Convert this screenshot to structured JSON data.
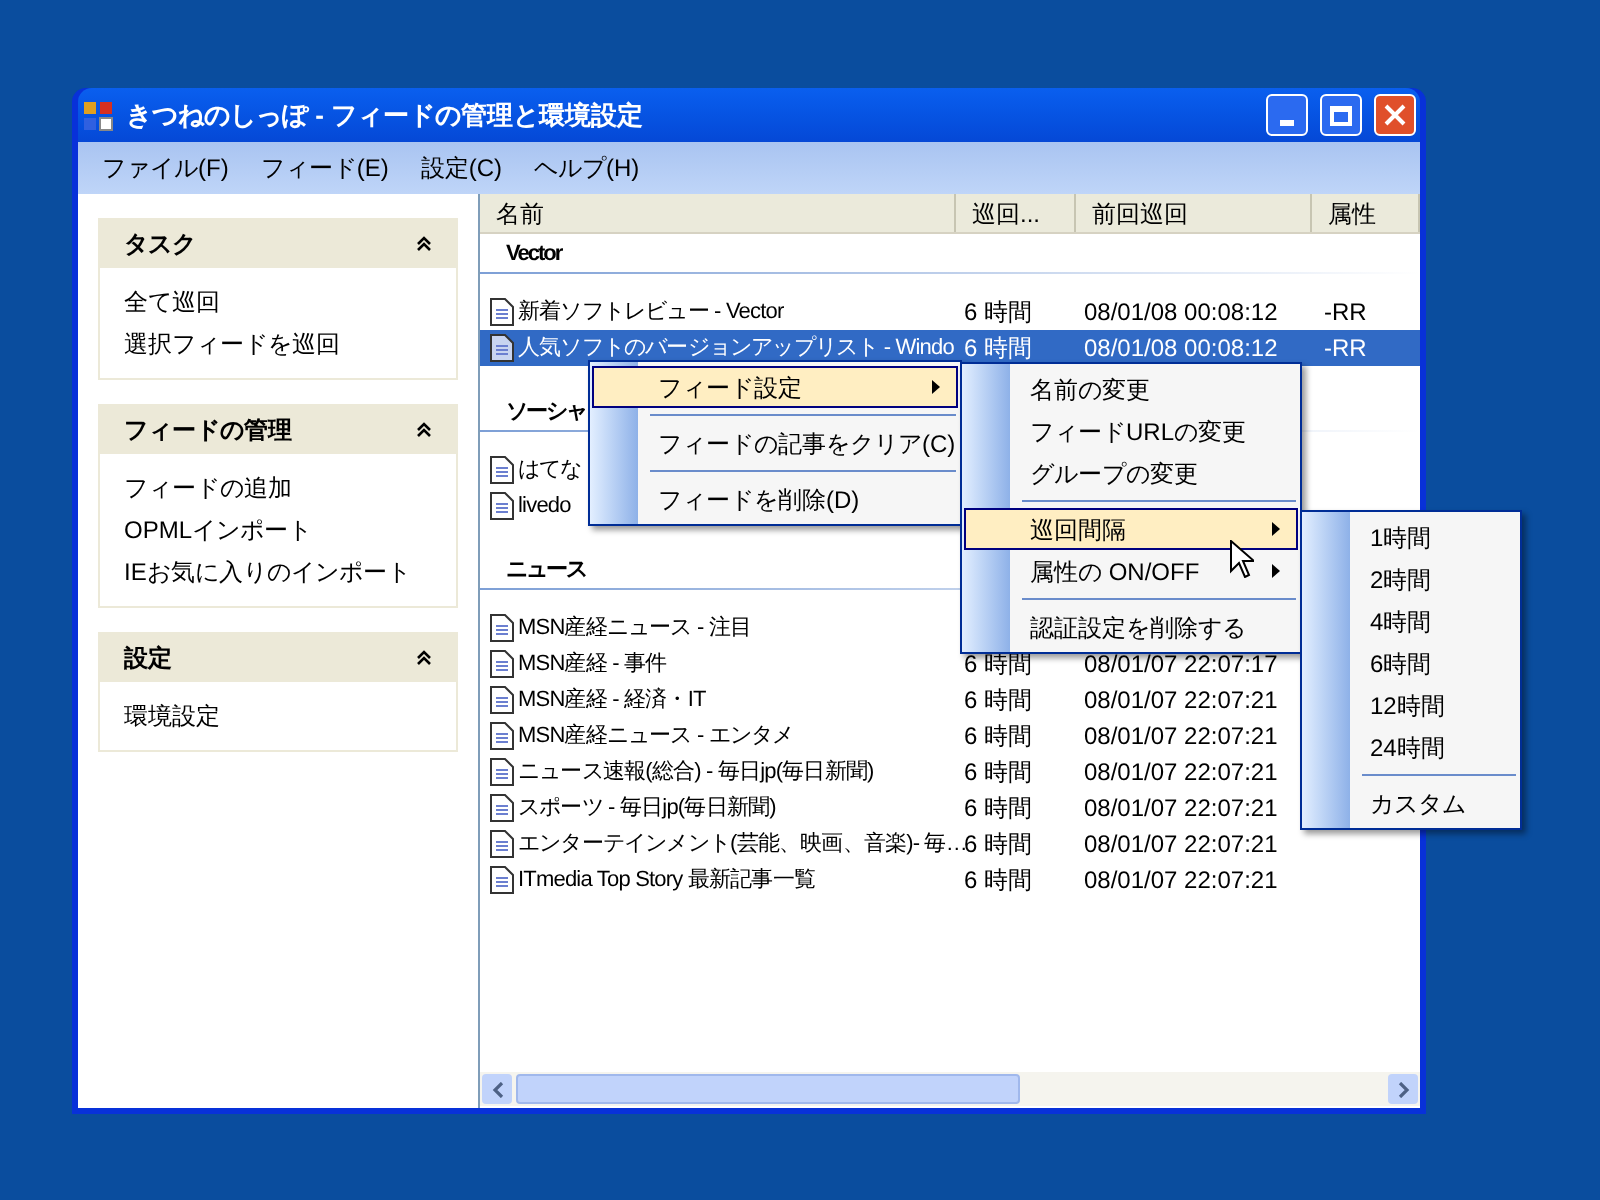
{
  "window": {
    "title": "きつねのしっぽ - フィードの管理と環境設定"
  },
  "menu_bar": [
    {
      "label": "ファイル(F)"
    },
    {
      "label": "フィード(E)"
    },
    {
      "label": "設定(C)"
    },
    {
      "label": "ヘルプ(H)"
    }
  ],
  "sidebar": {
    "panels": [
      {
        "title": "タスク",
        "expanded": true,
        "items": [
          "全て巡回",
          "選択フィードを巡回"
        ]
      },
      {
        "title": "フィードの管理",
        "expanded": true,
        "items": [
          "フィードの追加",
          "OPMLインポート",
          "IEお気に入りのインポート"
        ]
      },
      {
        "title": "設定",
        "expanded": true,
        "items": [
          "環境設定"
        ]
      }
    ]
  },
  "list": {
    "columns": [
      "名前",
      "巡回...",
      "前回巡回",
      "属性"
    ],
    "groups": [
      {
        "name": "Vector",
        "rows": [
          {
            "name": "新着ソフトレビュー - Vector",
            "interval": "6 時間",
            "last": "08/01/08 00:08:12",
            "attr": "-RR",
            "selected": false
          },
          {
            "name": "人気ソフトのバージョンアップリスト - Windo",
            "interval": "6 時間",
            "last": "08/01/08 00:08:12",
            "attr": "-RR",
            "selected": true
          }
        ]
      },
      {
        "name": "ソーシャ",
        "rows": [
          {
            "name": "はてな",
            "selected": false
          },
          {
            "name": "livedo",
            "selected": false
          }
        ]
      },
      {
        "name": "ニュース",
        "rows": [
          {
            "name": "MSN産経ニュース - 注目",
            "selected": false
          },
          {
            "name": "MSN産経 - 事件",
            "interval": "6 時間",
            "last": "08/01/07 22:07:17",
            "selected": false
          },
          {
            "name": "MSN産経 - 経済・IT",
            "interval": "6 時間",
            "last": "08/01/07 22:07:21",
            "selected": false
          },
          {
            "name": "MSN産経ニュース - エンタメ",
            "interval": "6 時間",
            "last": "08/01/07 22:07:21",
            "selected": false
          },
          {
            "name": "ニュース速報(総合) - 毎日jp(毎日新聞)",
            "interval": "6 時間",
            "last": "08/01/07 22:07:21",
            "selected": false
          },
          {
            "name": "スポーツ - 毎日jp(毎日新聞)",
            "interval": "6 時間",
            "last": "08/01/07 22:07:21",
            "selected": false
          },
          {
            "name": "エンターテインメント(芸能、映画、音楽)- 毎…",
            "interval": "6 時間",
            "last": "08/01/07 22:07:21",
            "selected": false
          },
          {
            "name": "ITmedia Top Story 最新記事一覧",
            "interval": "6 時間",
            "last": "08/01/07 22:07:21",
            "selected": false
          }
        ]
      }
    ]
  },
  "context_menus": [
    {
      "items": [
        {
          "kind": "item",
          "label": "フィード設定",
          "selected": true,
          "submenu": true
        },
        {
          "kind": "separator"
        },
        {
          "kind": "item",
          "label": "フィードの記事をクリア(C)",
          "selected": false,
          "submenu": false
        },
        {
          "kind": "separator"
        },
        {
          "kind": "item",
          "label": "フィードを削除(D)",
          "selected": false,
          "submenu": false
        }
      ]
    },
    {
      "items": [
        {
          "kind": "item",
          "label": "名前の変更",
          "selected": false,
          "submenu": false
        },
        {
          "kind": "item",
          "label": "フィードURLの変更",
          "selected": false,
          "submenu": false
        },
        {
          "kind": "item",
          "label": "グループの変更",
          "selected": false,
          "submenu": false
        },
        {
          "kind": "separator"
        },
        {
          "kind": "item",
          "label": "巡回間隔",
          "selected": true,
          "submenu": true
        },
        {
          "kind": "item",
          "label": "属性の ON/OFF",
          "selected": false,
          "submenu": true
        },
        {
          "kind": "separator"
        },
        {
          "kind": "item",
          "label": "認証設定を削除する",
          "selected": false,
          "submenu": false
        }
      ]
    },
    {
      "items": [
        {
          "kind": "item",
          "label": "1時間",
          "selected": false,
          "submenu": false
        },
        {
          "kind": "item",
          "label": "2時間",
          "selected": false,
          "submenu": false
        },
        {
          "kind": "item",
          "label": "4時間",
          "selected": false,
          "submenu": false
        },
        {
          "kind": "item",
          "label": "6時間",
          "selected": false,
          "submenu": false
        },
        {
          "kind": "item",
          "label": "12時間",
          "selected": false,
          "submenu": false
        },
        {
          "kind": "item",
          "label": "24時間",
          "selected": false,
          "submenu": false
        },
        {
          "kind": "separator"
        },
        {
          "kind": "item",
          "label": "カスタム",
          "selected": false,
          "submenu": false
        }
      ]
    }
  ]
}
